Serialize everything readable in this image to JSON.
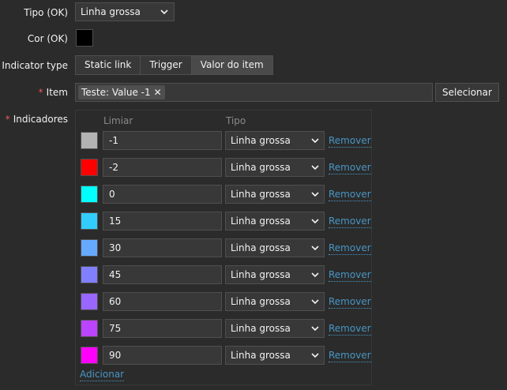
{
  "form": {
    "tipo_ok_label": "Tipo (OK)",
    "tipo_ok_value": "Linha grossa",
    "cor_ok_label": "Cor (OK)",
    "cor_ok_color": "#000000",
    "indicator_type_label": "Indicator type",
    "indicator_types": [
      {
        "label": "Static link",
        "active": false
      },
      {
        "label": "Trigger",
        "active": false
      },
      {
        "label": "Valor do item",
        "active": true
      }
    ],
    "item_label": "Item",
    "item_chip": "Teste: Value -1",
    "select_button": "Selecionar",
    "indicadores_label": "Indicadores",
    "required_mark": "*"
  },
  "indicators": {
    "col_limiar": "Limiar",
    "col_tipo": "Tipo",
    "remove_label": "Remover",
    "add_label": "Adicionar",
    "rows": [
      {
        "color": "#b3b3b3",
        "threshold": "-1",
        "type": "Linha grossa"
      },
      {
        "color": "#ff0000",
        "threshold": "-2",
        "type": "Linha grossa"
      },
      {
        "color": "#00ffff",
        "threshold": "0",
        "type": "Linha grossa"
      },
      {
        "color": "#33ccff",
        "threshold": "15",
        "type": "Linha grossa"
      },
      {
        "color": "#66aaff",
        "threshold": "30",
        "type": "Linha grossa"
      },
      {
        "color": "#8080ff",
        "threshold": "45",
        "type": "Linha grossa"
      },
      {
        "color": "#9966ff",
        "threshold": "60",
        "type": "Linha grossa"
      },
      {
        "color": "#bb44ff",
        "threshold": "75",
        "type": "Linha grossa"
      },
      {
        "color": "#ff00ff",
        "threshold": "90",
        "type": "Linha grossa"
      }
    ]
  },
  "icons": {
    "dropdown": "chevron-down-icon",
    "remove_chip": "close-icon"
  }
}
